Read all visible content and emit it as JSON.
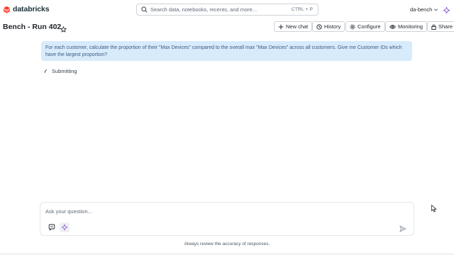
{
  "app": {
    "brand": "databricks",
    "brand_color": "#ff3621"
  },
  "search": {
    "placeholder": "Search data, notebooks, recents, and more...",
    "shortcut": "CTRL + P"
  },
  "workspace": {
    "name": "da-bench"
  },
  "header": {
    "title": "Bench - Run 402",
    "buttons": {
      "new_chat": "New chat",
      "history": "History",
      "configure": "Configure",
      "monitoring": "Monitoring",
      "share": "Share"
    }
  },
  "conversation": {
    "user_message": "For each customer, calculate the proportion of their \"Max Devices\" compared to the overall max \"Max Devices\" across all customers. Give me Customer IDs which have the largest proportion?",
    "status": "Submitting"
  },
  "composer": {
    "placeholder": "Ask your question...",
    "disclaimer": "Always review the accuracy of responses."
  },
  "colors": {
    "user_bubble": "#d7ebfb",
    "assistant_accent": "#8e5bd6"
  }
}
